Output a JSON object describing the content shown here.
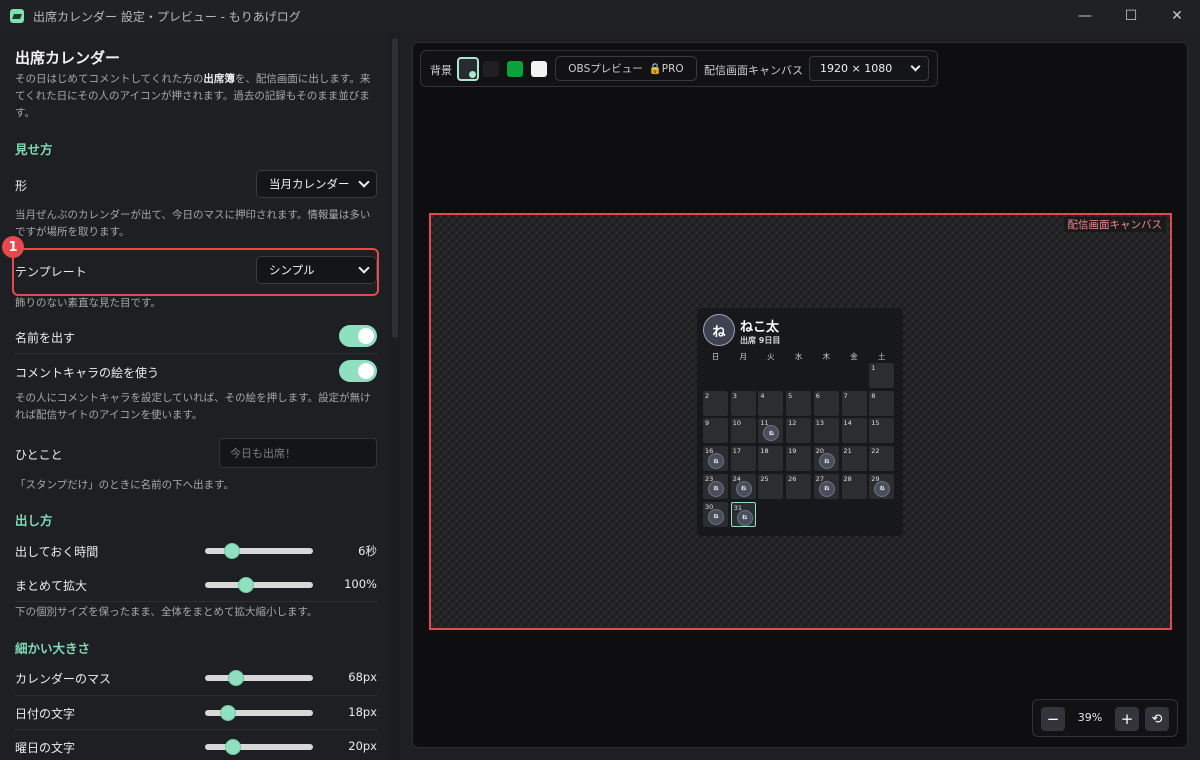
{
  "window": {
    "title": "出席カレンダー 設定・プレビュー - もりあげログ",
    "minimize": "—",
    "maximize": "☐",
    "close": "✕"
  },
  "panel": {
    "title": "出席カレンダー",
    "intro_1": "その日はじめてコメントしてくれた方の",
    "intro_bold": "出席簿",
    "intro_2": "を、配信画面に出します。来てくれた日にその人のアイコンが押されます。過去の記録もそのまま並びます。",
    "section_view": "見せ方",
    "shape_label": "形",
    "shape_value": "当月カレンダー",
    "shape_desc": "当月ぜんぶのカレンダーが出て、今日のマスに押印されます。情報量は多いですが場所を取ります。",
    "template_label": "テンプレート",
    "template_value": "シンプル",
    "template_desc": "飾りのない素直な見た目です。",
    "callout_number": "1",
    "show_name_label": "名前を出す",
    "show_name_on": true,
    "use_chara_label": "コメントキャラの絵を使う",
    "use_chara_on": true,
    "chara_desc": "その人にコメントキャラを設定していれば、その絵を押します。設定が無ければ配信サイトのアイコンを使います。",
    "hitokoto_label": "ひとこと",
    "hitokoto_placeholder": "今日も出席！",
    "hitokoto_desc": "「スタンプだけ」のときに名前の下へ出ます。",
    "section_display": "出し方",
    "duration_label": "出しておく時間",
    "duration_value": "6秒",
    "duration_level": 0.25,
    "scale_label": "まとめて拡大",
    "scale_value": "100%",
    "scale_level": 0.38,
    "scale_desc": "下の個別サイズを保ったまま、全体をまとめて拡大縮小します。",
    "section_size": "細かい大きさ",
    "cell_label": "カレンダーのマス",
    "cell_value": "68px",
    "cell_level": 0.29,
    "date_label": "日付の文字",
    "date_value": "18px",
    "date_level": 0.21,
    "weekday_label": "曜日の文字",
    "weekday_value": "20px",
    "weekday_level": 0.26
  },
  "toolbar": {
    "bg_label": "背景",
    "swatches": [
      "#1f1f22",
      "#0aa33a",
      "#f2f2f2"
    ],
    "obs_label": "OBSプレビュー",
    "pro_label": "🔒PRO",
    "canvas_label": "配信画面キャンバス",
    "canvas_size": "1920 × 1080"
  },
  "preview": {
    "canvas_tag": "配信画面キャンバス",
    "avatar_char": "ね",
    "name": "ねこ太",
    "attendance": "出席 9日目",
    "stamp_char": "ね",
    "weekdays": [
      "日",
      "月",
      "火",
      "水",
      "木",
      "金",
      "土"
    ],
    "first_weekday_index": 6,
    "days_in_month": 31,
    "stamped_days": [
      11,
      16,
      20,
      23,
      24,
      27,
      29,
      30,
      31
    ],
    "today": 31
  },
  "zoom": {
    "minus": "−",
    "value": "39%",
    "plus": "+",
    "reset": "⟲"
  }
}
